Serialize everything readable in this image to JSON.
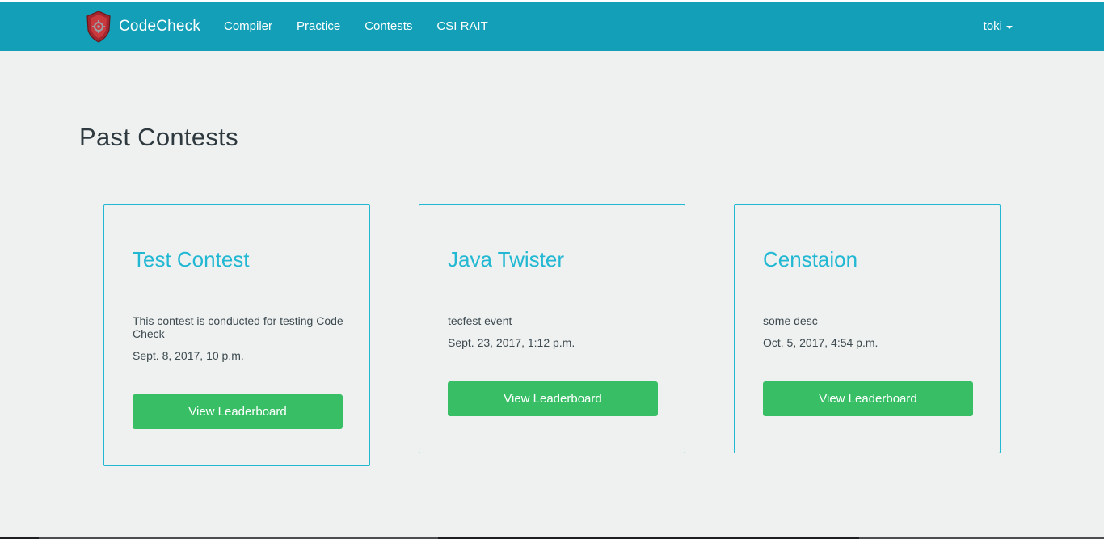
{
  "navbar": {
    "brand": "CodeCheck",
    "links": [
      "Compiler",
      "Practice",
      "Contests",
      "CSI RAIT"
    ],
    "user": "toki"
  },
  "page": {
    "title": "Past Contests"
  },
  "contests": [
    {
      "title": "Test Contest",
      "description": "This contest is conducted for testing Code Check",
      "date": "Sept. 8, 2017, 10 p.m.",
      "button": "View Leaderboard"
    },
    {
      "title": "Java Twister",
      "description": "tecfest event",
      "date": "Sept. 23, 2017, 1:12 p.m.",
      "button": "View Leaderboard"
    },
    {
      "title": "Censtaion",
      "description": "some desc",
      "date": "Oct. 5, 2017, 4:54 p.m.",
      "button": "View Leaderboard"
    }
  ],
  "colors": {
    "navbar": "#139fb7",
    "accent": "#22b8d3",
    "button": "#38bf66",
    "background": "#eff1f0"
  },
  "icons": {
    "brand": "shield-logo-icon",
    "user_menu": "caret-down-icon"
  }
}
